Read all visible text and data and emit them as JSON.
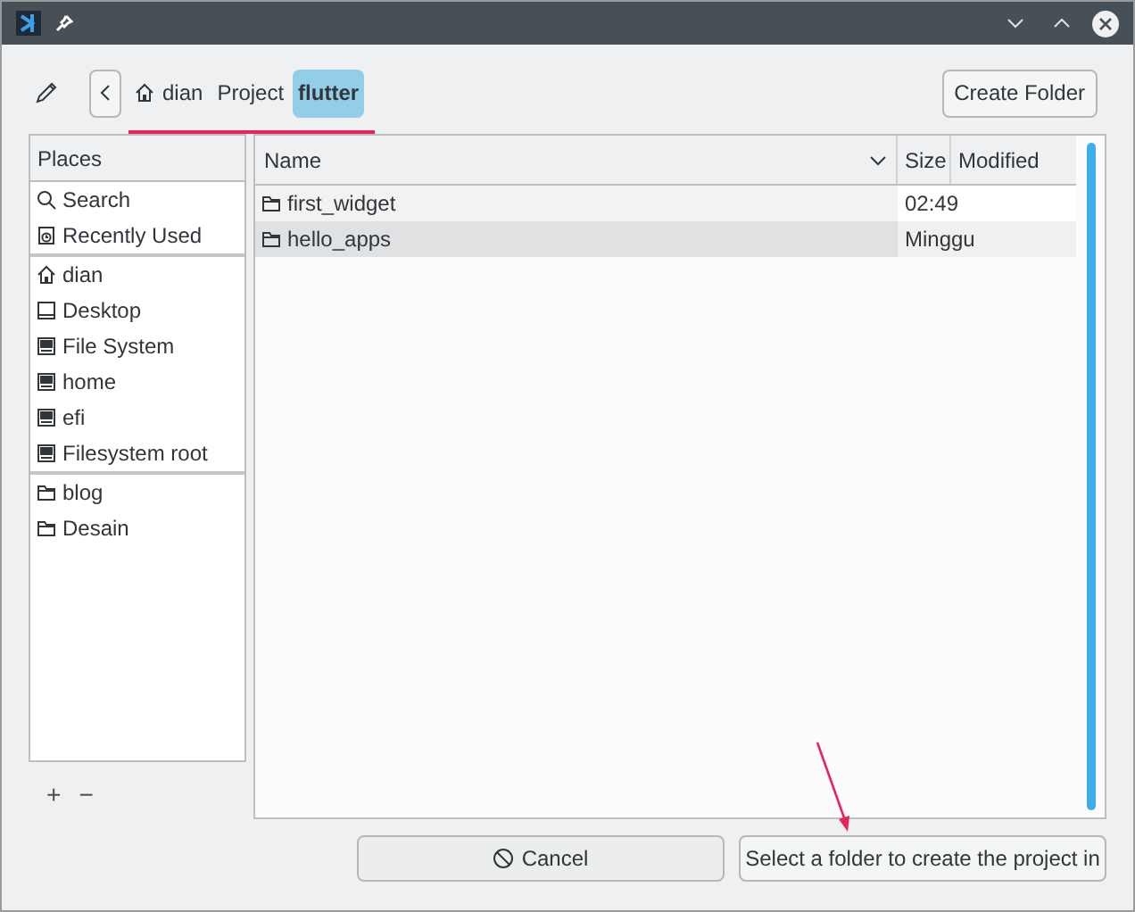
{
  "breadcrumb": [
    {
      "label": "dian",
      "kind": "home",
      "selected": false
    },
    {
      "label": "Project",
      "kind": "plain",
      "selected": false
    },
    {
      "label": "flutter",
      "kind": "plain",
      "selected": true
    }
  ],
  "create_folder_button": "Create Folder",
  "places": {
    "header": "Places",
    "sections": [
      [
        {
          "label": "Search",
          "kind": "search"
        },
        {
          "label": "Recently Used",
          "kind": "recent"
        }
      ],
      [
        {
          "label": "dian",
          "kind": "home"
        },
        {
          "label": "Desktop",
          "kind": "desktop"
        },
        {
          "label": "File System",
          "kind": "drive"
        },
        {
          "label": "home",
          "kind": "drive"
        },
        {
          "label": "efi",
          "kind": "drive"
        },
        {
          "label": "Filesystem root",
          "kind": "drive"
        }
      ],
      [
        {
          "label": "blog",
          "kind": "folder"
        },
        {
          "label": "Desain",
          "kind": "folder"
        }
      ]
    ],
    "add": "+",
    "remove": "−"
  },
  "table": {
    "columns": [
      "Name",
      "Size",
      "Modified"
    ],
    "rows": [
      {
        "name": "first_widget",
        "modified": "02:49",
        "selected": false
      },
      {
        "name": "hello_apps",
        "modified": "Minggu",
        "selected": true
      }
    ]
  },
  "buttons": {
    "cancel": "Cancel",
    "select": "Select a folder to create the project in"
  }
}
